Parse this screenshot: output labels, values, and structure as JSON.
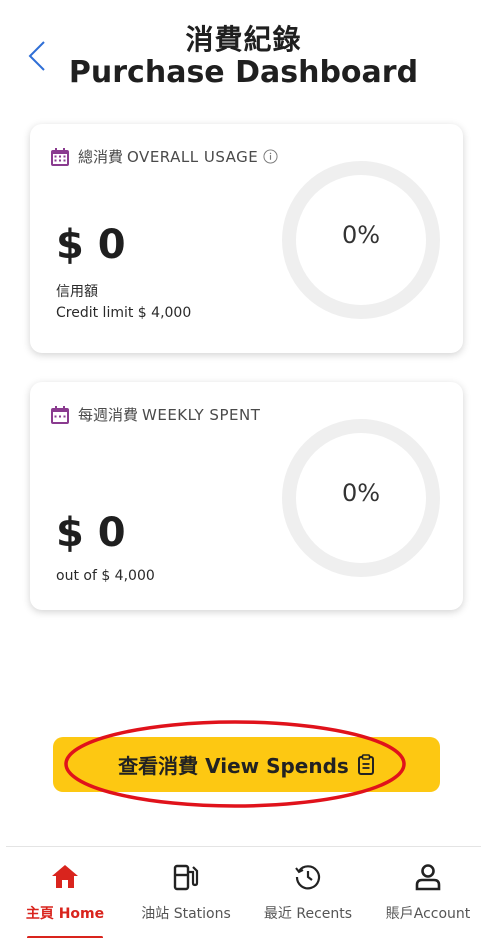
{
  "header": {
    "title_zh": "消費紀錄",
    "title_en": "Purchase Dashboard"
  },
  "overall": {
    "label_zh": "總消費",
    "label_en": "OVERALL USAGE",
    "amount": "$ 0",
    "percent_text": "0%",
    "percent_value": 0,
    "credit_label_zh": "信用額",
    "credit_label_en": "Credit limit $ 4,000"
  },
  "weekly": {
    "label_zh": "每週消費",
    "label_en": "WEEKLY SPENT",
    "amount": "$ 0",
    "percent_text": "0%",
    "percent_value": 0,
    "out_of": "out of $ 4,000"
  },
  "view_spends": {
    "label": "查看消費 View Spends"
  },
  "nav": {
    "items": [
      {
        "label_zh": "主頁",
        "label_en": "Home",
        "icon": "home-icon",
        "active": true
      },
      {
        "label_zh": "油站",
        "label_en": "Stations",
        "icon": "fuel-station-icon",
        "active": false
      },
      {
        "label_zh": "最近",
        "label_en": "Recents",
        "icon": "history-icon",
        "active": false
      },
      {
        "label_zh": "賬戶",
        "label_en": "Account",
        "icon": "user-icon",
        "active": false
      }
    ]
  },
  "colors": {
    "accent_red": "#d9241d",
    "button_yellow": "#fdc812",
    "calendar_purple": "#8a3b8f",
    "ring_track": "#efefef"
  }
}
